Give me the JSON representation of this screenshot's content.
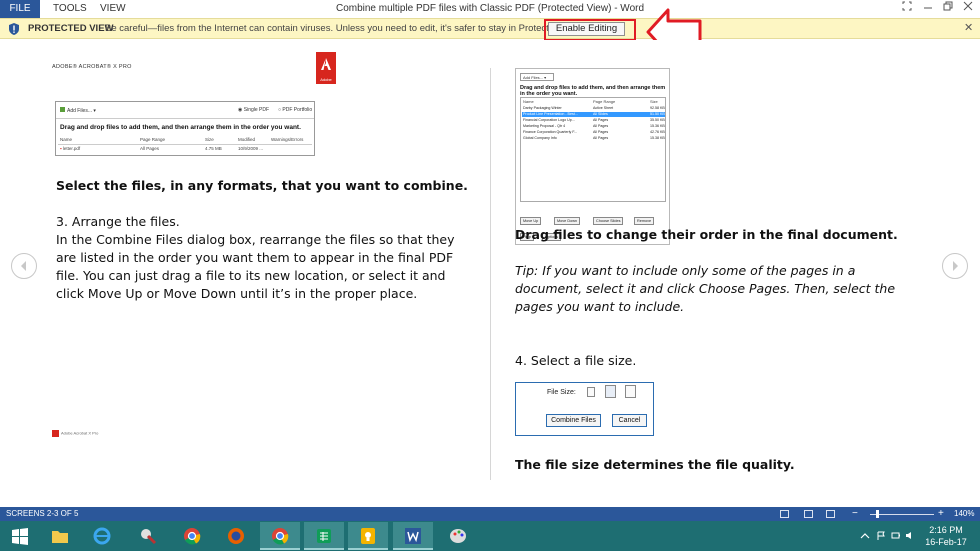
{
  "window": {
    "title": "Combine multiple PDF files with Classic PDF (Protected View) - Word",
    "menu": {
      "file": "FILE",
      "tools": "TOOLS",
      "view": "VIEW"
    }
  },
  "protected_view": {
    "label": "PROTECTED VIEW",
    "message": "Be careful—files from the Internet can contain viruses. Unless you need to edit, it's safer to stay in Protected View.",
    "enable_button": "Enable Editing"
  },
  "left_page": {
    "brand": "ADOBE® ACROBAT® X PRO",
    "logo_text": "Adobe",
    "screenshot": {
      "add_files": "Add Files... ▾",
      "single_pdf": "Single PDF",
      "pdf_portfolio": "PDF Portfolio",
      "drag_text": "Drag and drop files to add them, and then arrange them in the order you want.",
      "columns": [
        "Name",
        "Page Range",
        "Size",
        "Modified",
        "Warnings/Errors"
      ],
      "row": [
        "letter.pdf",
        "All Pages",
        "4.75 MB",
        "10/9/2009 ..."
      ]
    },
    "caption": "Select the files, in any formats, that you want to combine.",
    "step_heading": "3.  Arrange the files.",
    "step_body": "In the Combine Files dialog box, rearrange the files so that they are listed in the order you want them to appear in the final PDF file. You can just drag a file to its new location, or select it and click Move Up or Move Down until it’s in the proper place.",
    "footer_logo": "Adobe Acrobat X Pro"
  },
  "right_page": {
    "screenshot": {
      "add_files": "Add Files... ▾",
      "drag_text": "Drag and drop files to add them, and then arrange them in the order you want.",
      "columns": [
        "Name",
        "Page Range",
        "Size"
      ],
      "rows": [
        [
          "Darby Packaging Winter",
          "Active Sheet",
          "92.58 KB"
        ],
        [
          "Product Line Presentation - Best...",
          "All Slides",
          "51.50 KB"
        ],
        [
          "Financial Corporation Logo Up...",
          "All Pages",
          "35.50 KB"
        ],
        [
          "Marketing Proposal - Qtr 4",
          "All Pages",
          "15.36 KB"
        ],
        [
          "Finance Corporation Quarterly F...",
          "All Pages",
          "42.76 KB"
        ],
        [
          "Global Company Info",
          "All Pages",
          "15.38 KB"
        ]
      ],
      "buttons": [
        "Move Up",
        "Move Down",
        "Choose Slides",
        "Remove"
      ],
      "help": "Help",
      "options": "Options"
    },
    "caption1": "Drag files to change their order in the final document.",
    "tip": "Tip: If you want to include only some of the pages in a document, select it and click Choose Pages. Then, select the pages you want to include.",
    "step4": "4.  Select a file size.",
    "file_size": {
      "label": "File Size:",
      "combine": "Combine Files",
      "cancel": "Cancel"
    },
    "caption2": "The file size determines the file quality."
  },
  "status": {
    "screens": "SCREENS 2-3 OF 5",
    "zoom": "140%"
  },
  "taskbar": {
    "time": "2:16 PM",
    "date": "16-Feb-17"
  }
}
